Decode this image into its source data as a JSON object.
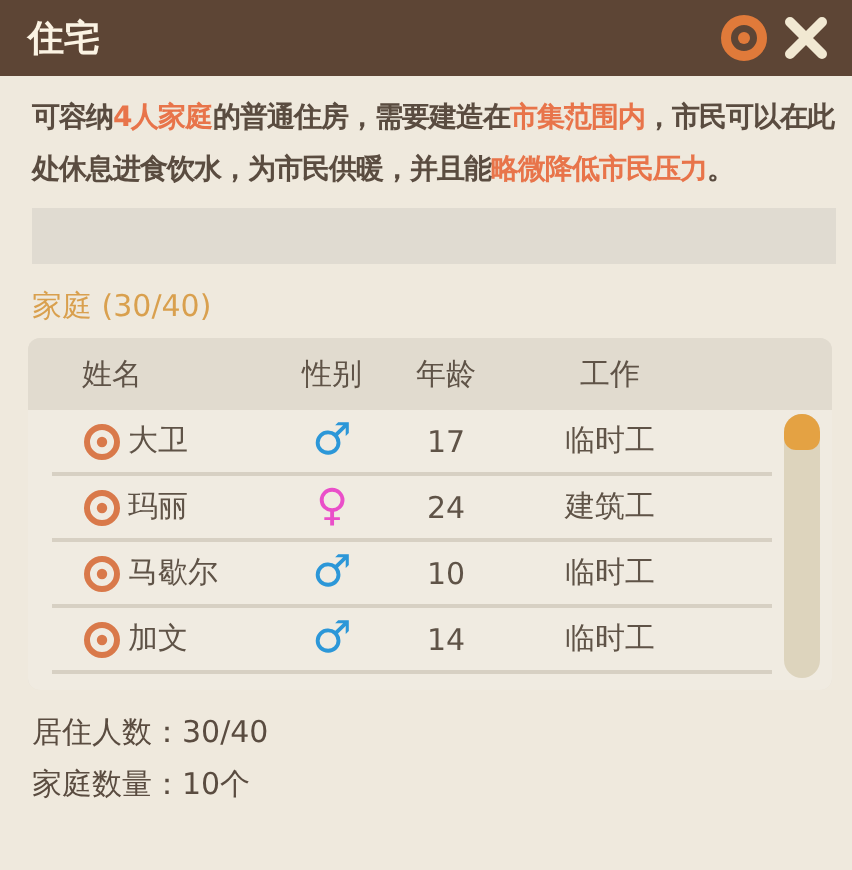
{
  "window": {
    "title": "住宅"
  },
  "description": "可容纳**4人家庭**的普通住房，需要建造在**市集范围内**，市民可以在此处休息进食饮水，为市民供暖，并且能**略微降低市民压力**。",
  "section_title": "家庭 (30/40)",
  "table": {
    "columns": [
      "姓名",
      "性别",
      "年龄",
      "工作"
    ],
    "rows": [
      {
        "name": "大卫",
        "gender": "♂",
        "kind": "male",
        "age": "17",
        "job": "临时工"
      },
      {
        "name": "玛丽",
        "gender": "♀",
        "kind": "female",
        "age": "24",
        "job": "建筑工"
      },
      {
        "name": "马歇尔",
        "gender": "♂",
        "kind": "male",
        "age": "10",
        "job": "临时工"
      },
      {
        "name": "加文",
        "gender": "♂",
        "kind": "male",
        "age": "14",
        "job": "临时工"
      }
    ]
  },
  "stats": [
    {
      "label": "居住人数：",
      "value": "30/40"
    },
    {
      "label": "家庭数量：",
      "value": "10个"
    }
  ]
}
